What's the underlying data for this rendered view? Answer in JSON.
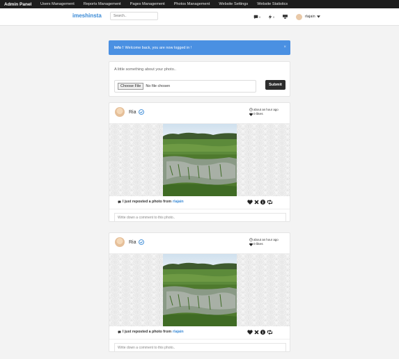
{
  "adminbar": {
    "brand": "Admin Panel",
    "menu": [
      "Users Management",
      "Reports Management",
      "Pages Management",
      "Photos Management",
      "Website Settings",
      "Website Statistics"
    ]
  },
  "nav": {
    "logo": "imeshinsta",
    "search_placeholder": "Search..",
    "messages_count": "0",
    "notifications_count": "0",
    "username": "rlajain"
  },
  "alert": {
    "title": "Info !",
    "message": "Welcome back, you are now logged in !",
    "close": "×"
  },
  "upload": {
    "label": "A little something about your photo..",
    "choose_file": "Choose File",
    "no_file": "No file chosen",
    "submit": "Submit"
  },
  "posts": [
    {
      "author": "Ria",
      "time": "about an hour ago",
      "likes": "0 likes",
      "caption": "I just reposted a photo from",
      "source_user": "rlajain",
      "comment_placeholder": "Write down a comment to this photo.."
    },
    {
      "author": "Ria",
      "time": "about an hour ago",
      "likes": "0 likes",
      "caption": "I just reposted a photo from",
      "source_user": "rlajain",
      "comment_placeholder": "Write down a comment to this photo.."
    }
  ],
  "colors": {
    "accent": "#3a8ad6",
    "alert": "#4a90e2",
    "adminbar": "#1d1d1d",
    "submit": "#2d2d2d"
  }
}
